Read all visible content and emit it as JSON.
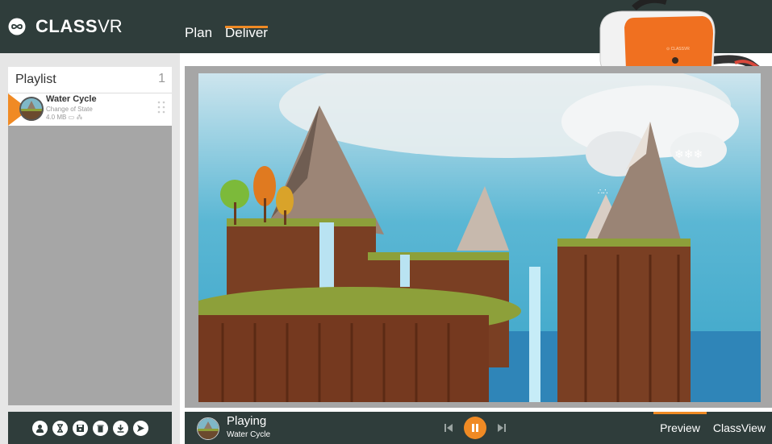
{
  "brand": {
    "bold": "CLASS",
    "light": "VR"
  },
  "nav": [
    {
      "label": "Plan",
      "active": false
    },
    {
      "label": "Deliver",
      "active": true
    }
  ],
  "playlist": {
    "title": "Playlist",
    "count": "1",
    "items": [
      {
        "title": "Water Cycle",
        "subtitle": "Change of State",
        "size": "4.0 MB"
      }
    ]
  },
  "left_toolbar": [
    "person-icon",
    "hourglass-icon",
    "save-icon",
    "trash-icon",
    "download-icon",
    "send-icon"
  ],
  "now_playing": {
    "status": "Playing",
    "title": "Water Cycle"
  },
  "tabs": [
    {
      "label": "Preview",
      "active": true
    },
    {
      "label": "ClassView",
      "active": false
    }
  ],
  "colors": {
    "accent": "#f08a24",
    "header": "#2f3d3b",
    "panel": "#a6a6a6"
  }
}
